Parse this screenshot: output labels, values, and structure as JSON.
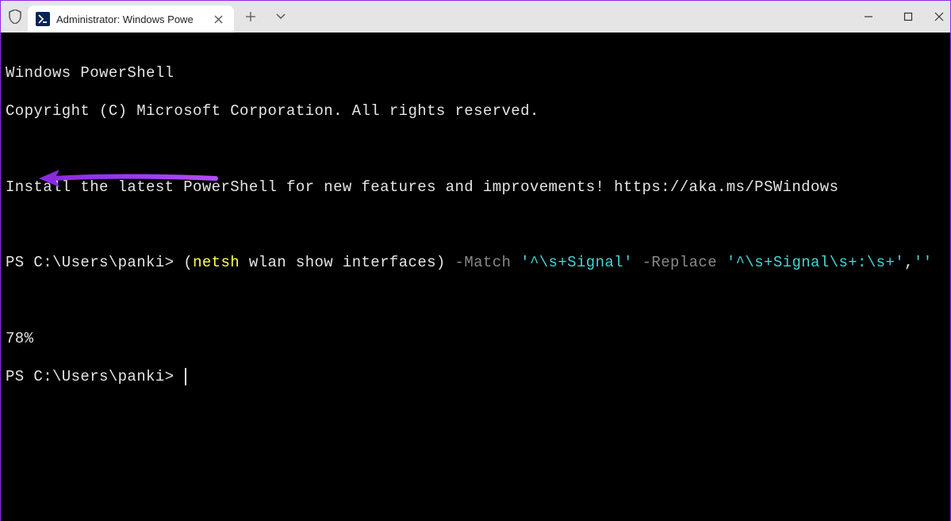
{
  "tab": {
    "title": "Administrator: Windows Powe"
  },
  "terminal": {
    "line1": "Windows PowerShell",
    "line2": "Copyright (C) Microsoft Corporation. All rights reserved.",
    "line3": "Install the latest PowerShell for new features and improvements! https://aka.ms/PSWindows",
    "prompt1": "PS C:\\Users\\panki> ",
    "cmd_paren_open": "(",
    "cmd_netsh": "netsh",
    "cmd_rest": " wlan show interfaces",
    "cmd_paren_close": ") ",
    "op_match": "-Match",
    "sp1": " ",
    "str_match": "'^\\s+Signal'",
    "sp2": " ",
    "op_replace": "-Replace",
    "sp3": " ",
    "str_replace1": "'^\\s+Signal\\s+:\\s+'",
    "comma": ",",
    "str_replace2": "''",
    "output": "78%",
    "prompt2": "PS C:\\Users\\panki> "
  }
}
